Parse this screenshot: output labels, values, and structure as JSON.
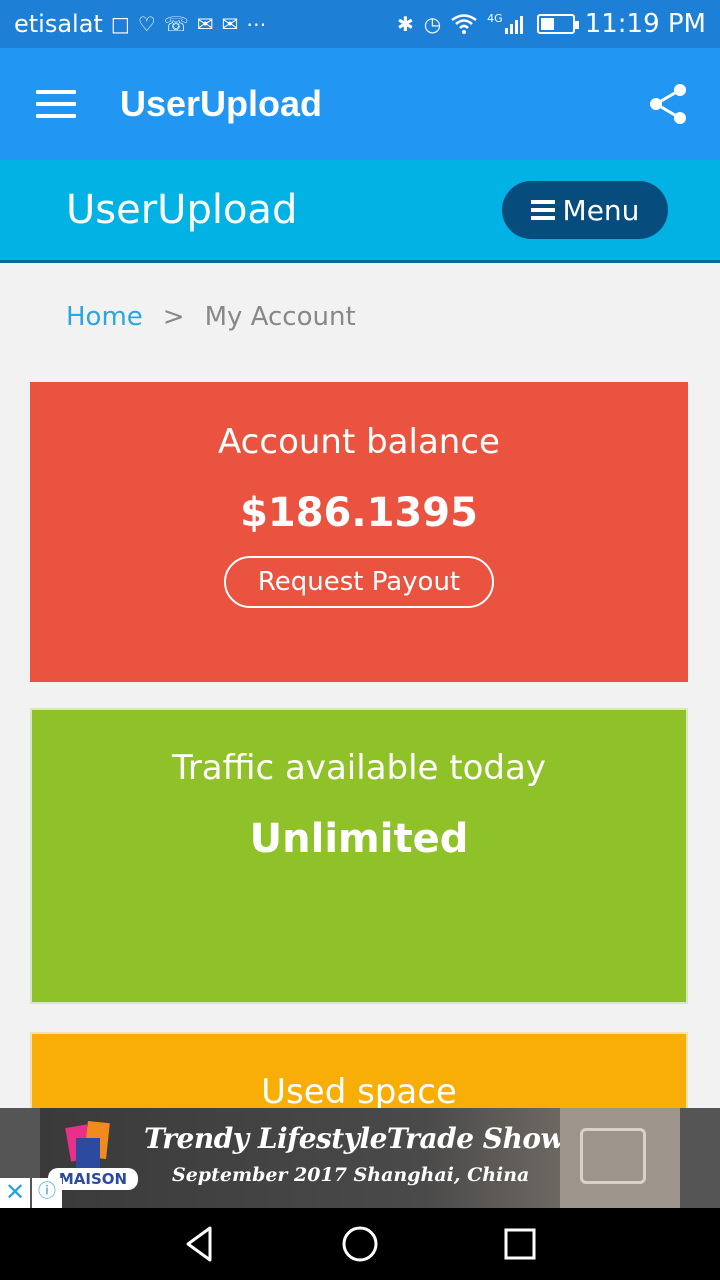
{
  "status_bar": {
    "carrier": "etisalat",
    "time": "11:19 PM",
    "network": "4G",
    "left_icons": [
      "laptop-icon",
      "heart-icon",
      "whatsapp-icon",
      "gmail-icon",
      "email-icon",
      "more-icon"
    ],
    "right_icons": [
      "bluetooth-icon",
      "alarm-icon",
      "wifi-icon",
      "signal-icon",
      "battery-icon"
    ]
  },
  "appbar": {
    "title": "UserUpload",
    "menu_icon": "hamburger-icon",
    "share_icon": "share-icon"
  },
  "site_header": {
    "title": "UserUpload",
    "menu_label": "Menu"
  },
  "breadcrumb": {
    "home": "Home",
    "separator": ">",
    "current": "My Account"
  },
  "cards": {
    "balance": {
      "label": "Account balance",
      "value": "$186.1395",
      "button": "Request Payout",
      "color": "#e95340"
    },
    "traffic": {
      "label": "Traffic available today",
      "value": "Unlimited",
      "color": "#8fc228"
    },
    "space": {
      "label": "Used space",
      "color": "#f9ad07"
    }
  },
  "ad": {
    "headline": "Trendy LifestyleTrade Show",
    "subline": "September 2017  Shanghai, China",
    "logo_text": "MAISON"
  },
  "nav": {
    "buttons": [
      "back-icon",
      "home-icon",
      "recents-icon"
    ]
  },
  "colors": {
    "status_bar": "#1e7fd6",
    "appbar": "#2196f3",
    "site_header": "#03b2e5",
    "menu_button": "#064d7e"
  }
}
